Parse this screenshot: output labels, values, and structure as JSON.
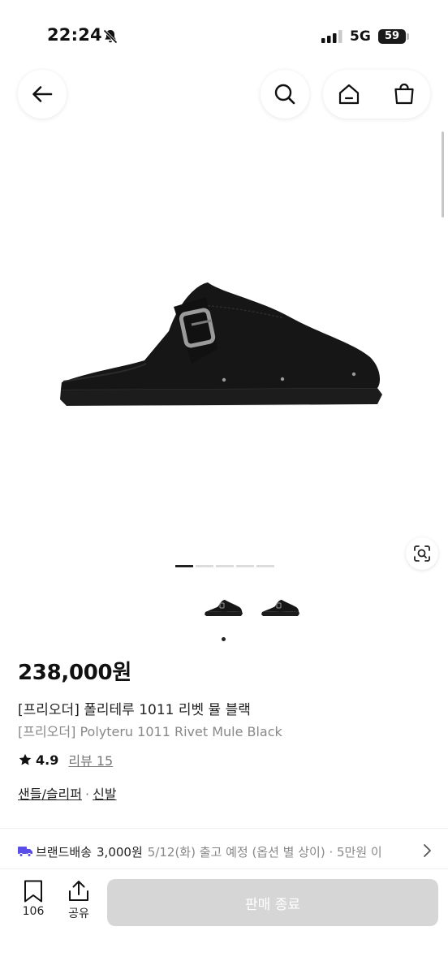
{
  "status_bar": {
    "time": "22:24",
    "network": "5G",
    "battery": "59"
  },
  "header": {
    "icons": [
      "back-arrow-icon",
      "search-icon",
      "home-icon",
      "shopping-bag-icon"
    ]
  },
  "gallery": {
    "slide_count": 5,
    "active_slide": 1,
    "thumbnail_count": 2,
    "lens_icon": "image-search-icon"
  },
  "product": {
    "price": "238,000원",
    "title_ko": "[프리오더] 폴리테루 1011 리벳 뮬 블랙",
    "title_en": "[프리오더] Polyteru 1011 Rivet Mule Black",
    "rating": "4.9",
    "review_label": "리뷰 15",
    "category_1": "샌들/슬리퍼",
    "category_sep": "·",
    "category_2": "신발"
  },
  "delivery": {
    "label": "브랜드배송",
    "price": "3,000원",
    "note": "5/12(화) 출고 예정 (옵션 별 상이) · 5만원 이",
    "icon": "truck-icon"
  },
  "bottom_bar": {
    "like_count": "106",
    "share_label": "공유",
    "cta_label": "판매 종료"
  },
  "colors": {
    "delivery_icon": "#5b4ee8",
    "cta_disabled": "#d6d6d6"
  }
}
